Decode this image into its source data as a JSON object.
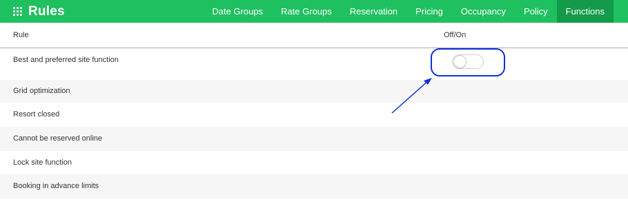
{
  "app": {
    "title": "Rules",
    "brand_color": "#1fc05f",
    "active_tab_color": "#139a4a"
  },
  "nav": {
    "items": [
      {
        "label": "Date Groups",
        "active": false
      },
      {
        "label": "Rate Groups",
        "active": false
      },
      {
        "label": "Reservation",
        "active": false
      },
      {
        "label": "Pricing",
        "active": false
      },
      {
        "label": "Occupancy",
        "active": false
      },
      {
        "label": "Policy",
        "active": false
      },
      {
        "label": "Functions",
        "active": true
      }
    ]
  },
  "table": {
    "headers": {
      "rule": "Rule",
      "toggle": "Off/On"
    },
    "rows": [
      {
        "label": "Best and preferred site function",
        "toggle_state": "off"
      },
      {
        "label": "Grid optimization"
      },
      {
        "label": "Resort closed"
      },
      {
        "label": "Cannot be reserved online"
      },
      {
        "label": "Lock site function"
      },
      {
        "label": "Booking in advance limits"
      }
    ]
  },
  "annotation": {
    "highlight_color": "#1030d8",
    "target": "best-preferred-site-toggle"
  }
}
